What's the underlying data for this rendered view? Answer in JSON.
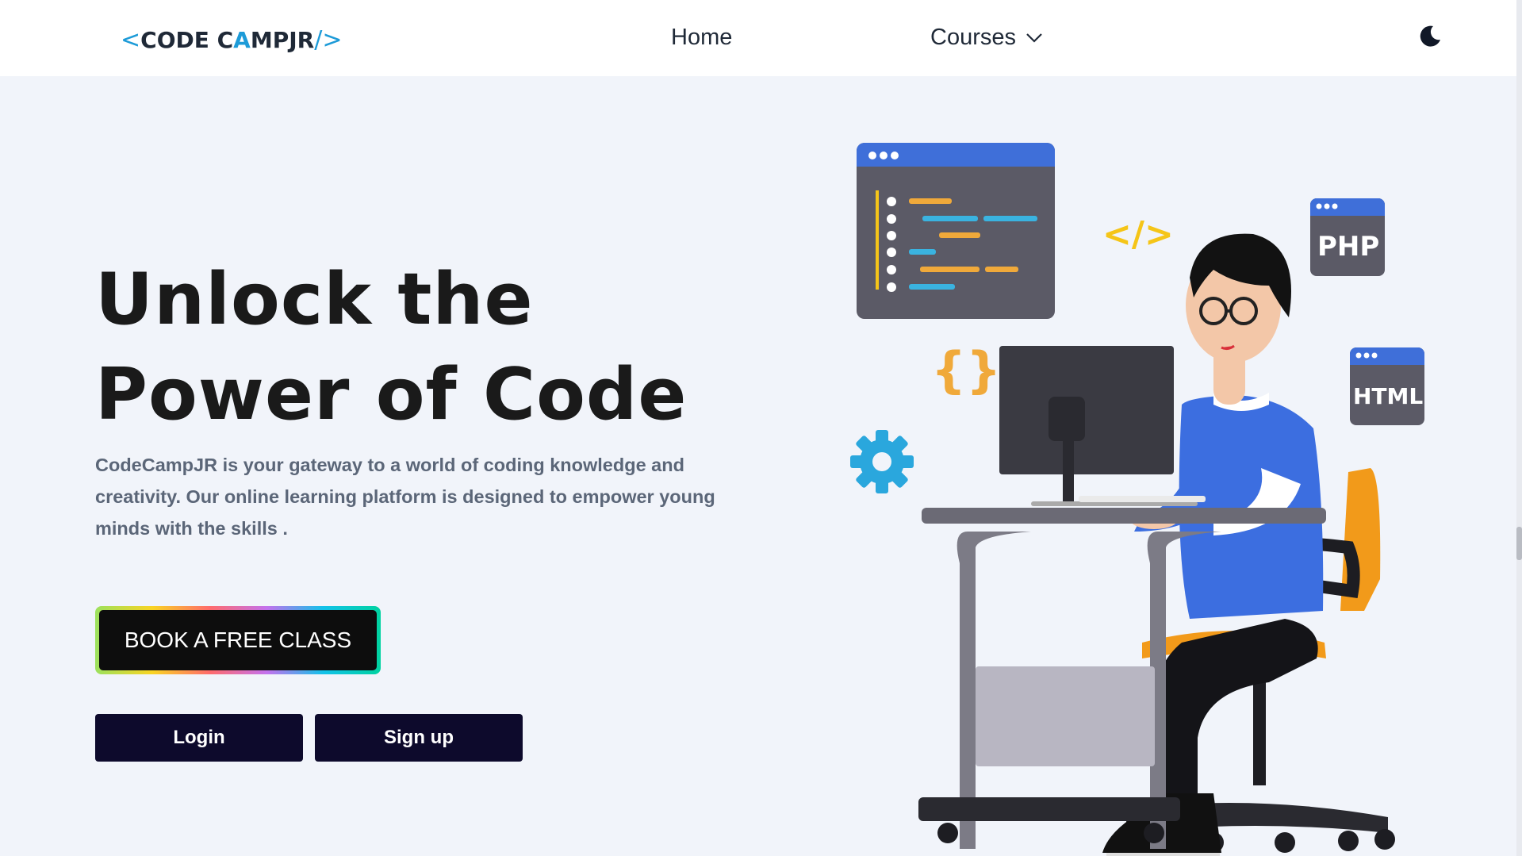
{
  "navbar": {
    "logo": {
      "left": "<",
      "text_code": "CODE C",
      "text_tent": "A",
      "text_rest": "MPJR",
      "right": "/>"
    },
    "links": {
      "home": "Home",
      "courses": "Courses"
    },
    "theme_toggle_icon": "moon-icon"
  },
  "hero": {
    "title_line1": "Unlock the",
    "title_line2": "Power of Code",
    "description": "CodeCampJR is your gateway to a world of coding knowledge and creativity. Our online learning platform is designed to empower young minds with the skills .",
    "cta_label": "BOOK A FREE CLASS",
    "login_label": "Login",
    "signup_label": "Sign up"
  },
  "illustration": {
    "badge_php": "PHP",
    "badge_html": "HTML",
    "code_tag": "</>",
    "braces": "{}"
  },
  "colors": {
    "accent_blue": "#1d9bd8",
    "button_navy": "#0d0a2c",
    "background": "#f1f4fa"
  }
}
